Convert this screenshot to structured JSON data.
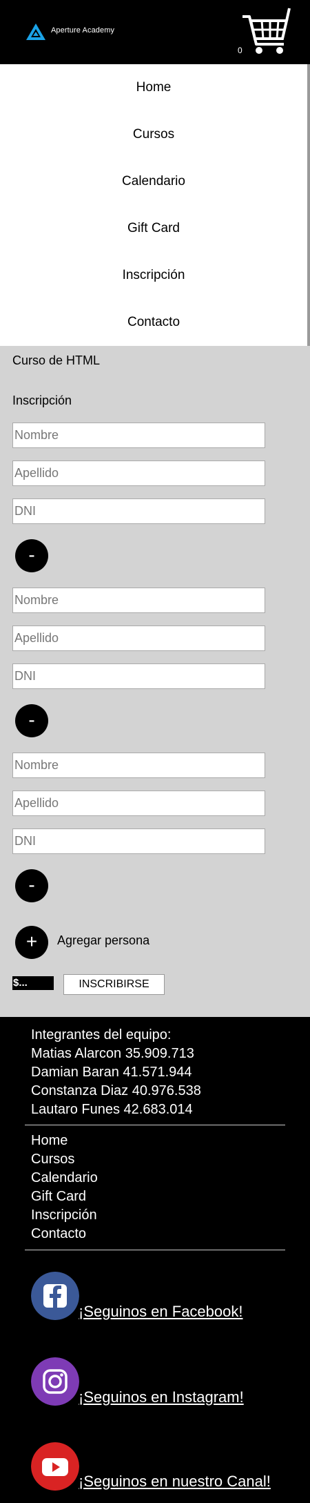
{
  "header": {
    "brand": "Aperture Academy",
    "cart_count": "0"
  },
  "nav": {
    "items": [
      "Home",
      "Cursos",
      "Calendario",
      "Gift Card",
      "Inscripción",
      "Contacto"
    ]
  },
  "main": {
    "course_title": "Curso de HTML",
    "form_heading": "Inscripción",
    "persons": [
      {
        "nombre_placeholder": "Nombre",
        "apellido_placeholder": "Apellido",
        "dni_placeholder": "DNI",
        "remove_label": "-"
      },
      {
        "nombre_placeholder": "Nombre",
        "apellido_placeholder": "Apellido",
        "dni_placeholder": "DNI",
        "remove_label": "-"
      },
      {
        "nombre_placeholder": "Nombre",
        "apellido_placeholder": "Apellido",
        "dni_placeholder": "DNI",
        "remove_label": "-"
      }
    ],
    "add_symbol": "+",
    "add_label": "Agregar persona",
    "total": "$...",
    "submit_label": "INSCRIBIRSE"
  },
  "footer": {
    "team_title": "Integrantes del equipo:",
    "members": [
      "Matias Alarcon 35.909.713",
      "Damian Baran 41.571.944",
      "Constanza Diaz 40.976.538",
      "Lautaro Funes 42.683.014"
    ],
    "links": [
      "Home",
      "Cursos",
      "Calendario",
      "Gift Card",
      "Inscripción",
      "Contacto"
    ],
    "social": {
      "facebook": "¡Seguinos en Facebook!",
      "instagram": "¡Seguinos en Instagram!",
      "youtube": "¡Seguinos en nuestro Canal!"
    }
  },
  "colors": {
    "header_bg": "#000000",
    "content_bg": "#d3d3d3",
    "facebook": "#3b5998",
    "instagram": "#7e3bb5",
    "youtube": "#d92323",
    "logo": "#1aa3e8"
  },
  "icons": {
    "logo": "aperture-logo-icon",
    "cart": "shopping-cart-icon",
    "facebook": "facebook-icon",
    "instagram": "instagram-icon",
    "youtube": "youtube-icon"
  }
}
